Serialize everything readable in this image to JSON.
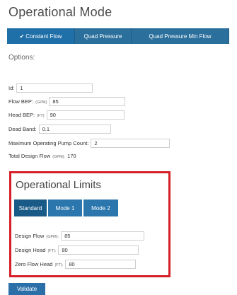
{
  "page": {
    "title": "Operational Mode"
  },
  "modes": [
    {
      "label": "Constant Flow",
      "checked": true
    },
    {
      "label": "Quad Pressure"
    },
    {
      "label": "Quad Pressure Min Flow"
    }
  ],
  "options_label": "Options:",
  "options": {
    "id": {
      "label": "Id:",
      "value": "1"
    },
    "flow_bep": {
      "label": "Flow BEP:",
      "unit": "(GPM)",
      "value": "85"
    },
    "head_bep": {
      "label": "Head BEP:",
      "unit": "(FT)",
      "value": "90"
    },
    "dead_band": {
      "label": "Dead Band:",
      "value": "0.1"
    },
    "max_pump_count": {
      "label": "Maximum Operating Pump Count:",
      "value": "2"
    },
    "total_design_flow": {
      "label": "Total Design Flow",
      "unit": "(GPM):",
      "value": "170"
    }
  },
  "limits": {
    "title": "Operational Limits",
    "buttons": [
      "Standard",
      "Mode 1",
      "Mode 2"
    ],
    "design_flow": {
      "label": "Design Flow",
      "unit": "(GPM):",
      "value": "85"
    },
    "design_head": {
      "label": "Design Head",
      "unit": "(FT):",
      "value": "80"
    },
    "zero_flow_head": {
      "label": "Zero Flow Head",
      "unit": "(FT):",
      "value": "80"
    }
  },
  "validate_label": "Validate",
  "colors": {
    "primary": "#1f6fa8",
    "highlight_border": "#d42027"
  }
}
